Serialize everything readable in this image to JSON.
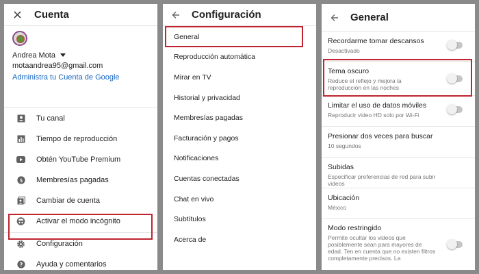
{
  "panel1": {
    "title": "Cuenta",
    "close_icon": "close-icon",
    "account": {
      "name": "Andrea Mota",
      "email": "motaandrea95@gmail.com",
      "manage_link": "Administra tu Cuenta de Google"
    },
    "menu": [
      {
        "label": "Tu canal",
        "icon": "person-icon"
      },
      {
        "label": "Tiempo de reproducción",
        "icon": "bar-chart-icon"
      },
      {
        "label": "Obtén YouTube Premium",
        "icon": "play-icon"
      },
      {
        "label": "Membresías pagadas",
        "icon": "dollar-icon"
      },
      {
        "label": "Cambiar de cuenta",
        "icon": "switch-account-icon"
      },
      {
        "label": "Activar el modo incógnito",
        "icon": "incognito-icon"
      },
      {
        "label": "Configuración",
        "icon": "gear-icon"
      },
      {
        "label": "Ayuda y comentarios",
        "icon": "help-icon"
      }
    ]
  },
  "panel2": {
    "title": "Configuración",
    "menu": [
      "General",
      "Reproducción automática",
      "Mirar en TV",
      "Historial y privacidad",
      "Membresías pagadas",
      "Facturación y pagos",
      "Notificaciones",
      "Cuentas conectadas",
      "Chat en vivo",
      "Subtítulos",
      "Acerca de"
    ]
  },
  "panel3": {
    "title": "General",
    "settings": [
      {
        "title": "Recordarme tomar descansos",
        "desc": "Desactivado",
        "toggle": false
      },
      {
        "title": "Tema oscuro",
        "desc": "Reduce el reflejo y mejora la reproducción en las noches",
        "toggle": false
      },
      {
        "title": "Limitar el uso de datos móviles",
        "desc": "Reproducir video HD solo por Wi-Fi",
        "toggle": false
      },
      {
        "title": "Presionar dos veces para buscar",
        "desc": "10 segundos"
      },
      {
        "title": "Subidas",
        "desc": "Especificar preferencias de red para subir videos"
      },
      {
        "title": "Ubicación",
        "desc": "México"
      },
      {
        "title": "Modo restringido",
        "desc": "Permite ocultar los videos que posiblemente sean para mayores de edad. Ten en cuenta que no existen filtros completamente precisos. La",
        "toggle": false
      }
    ]
  },
  "colors": {
    "highlight": "#c0222f",
    "link": "#1565c0",
    "background": "#8a8a8a"
  }
}
